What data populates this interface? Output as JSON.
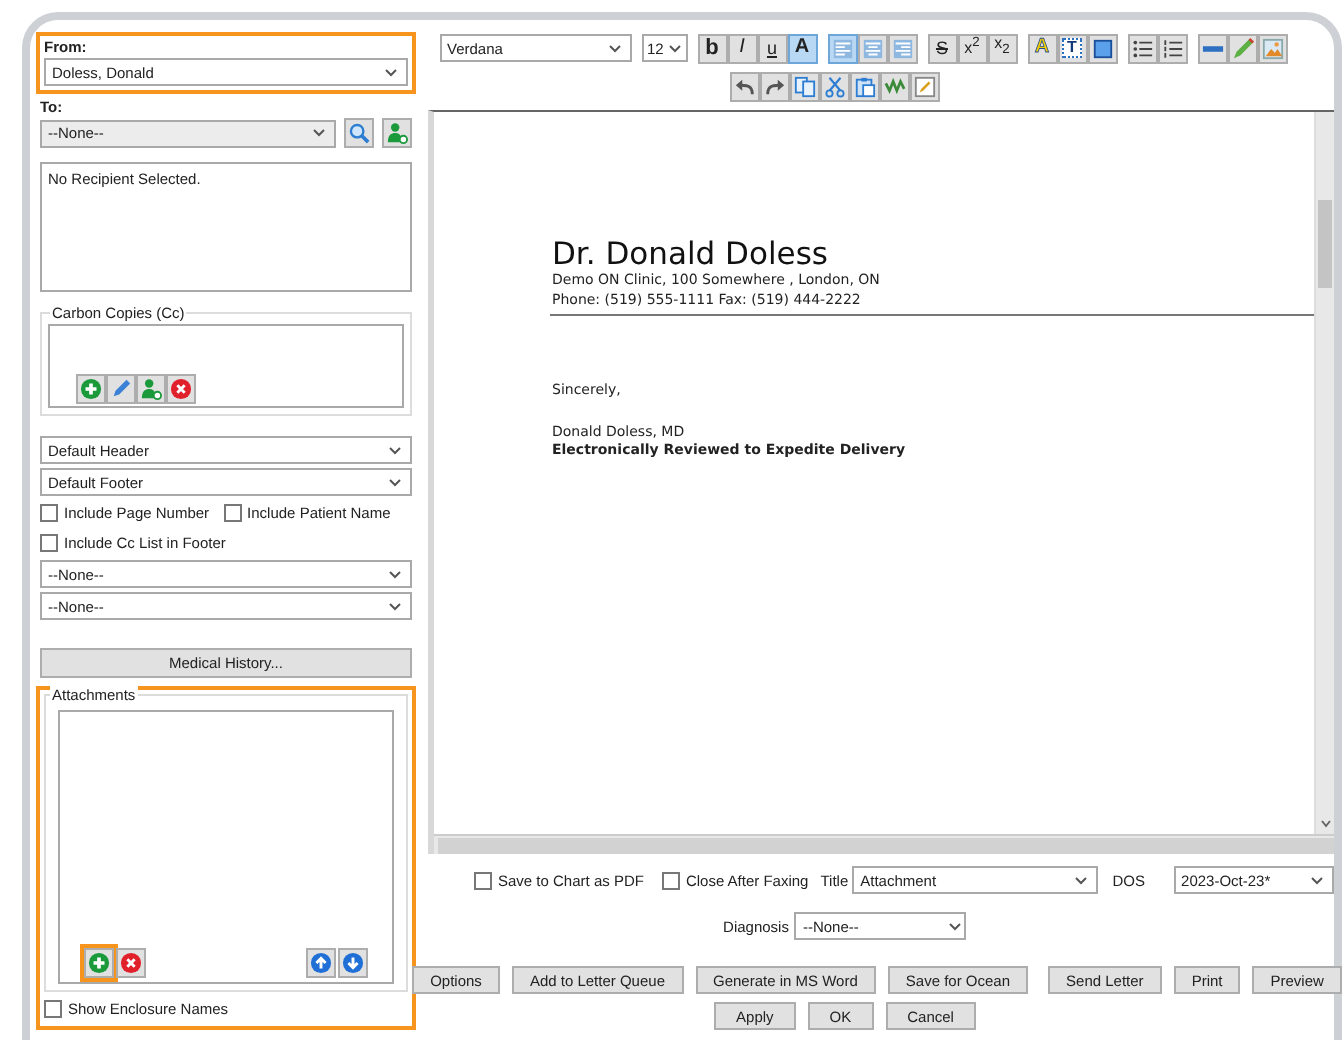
{
  "from": {
    "label": "From:",
    "value": "Doless, Donald",
    "highlighted": true
  },
  "to": {
    "label": "To:",
    "value": "--None--"
  },
  "recipients": {
    "text": "No Recipient Selected."
  },
  "carbon_copies": {
    "label": "Carbon Copies (Cc)"
  },
  "header": "Default Header",
  "footer": "Default Footer",
  "options": [
    {
      "label": "Include Page Number",
      "checked": false
    },
    {
      "label": "Include Patient Name",
      "checked": false
    },
    {
      "label": "Include Cc List in Footer",
      "checked": false
    }
  ],
  "selects": [
    "--None--",
    "--None--"
  ],
  "medical_history": "Medical History...",
  "attachments": {
    "label": "Attachments",
    "highlighted": true,
    "add_highlighted": true,
    "show_enclosure_names": {
      "label": "Show Enclosure Names",
      "checked": false
    }
  },
  "toolbar": {
    "font": "Verdana",
    "size": "12",
    "groups": [
      [
        {
          "kind": "bold",
          "label": "b",
          "selected": false
        },
        {
          "kind": "italic",
          "label": "I",
          "selected": false
        },
        {
          "kind": "underline",
          "label": "u",
          "selected": false
        },
        {
          "kind": "color",
          "label": "A",
          "selected": true
        }
      ],
      [
        {
          "kind": "align-left",
          "selected": true
        },
        {
          "kind": "align-center",
          "selected": false
        },
        {
          "kind": "align-right",
          "selected": false
        }
      ],
      [
        {
          "kind": "strike",
          "label": "S",
          "selected": false
        },
        {
          "kind": "superscript",
          "label": "x$^{2}$",
          "selected": false
        },
        {
          "kind": "subscript",
          "label": "x$_{2}$",
          "selected": false
        }
      ],
      [
        {
          "kind": "highlight",
          "label": "A",
          "selected": false
        },
        {
          "kind": "textbox",
          "label": "T",
          "selected": false
        },
        {
          "kind": "border",
          "selected": false
        }
      ],
      [
        {
          "kind": "bullets",
          "selected": false
        },
        {
          "kind": "numbered",
          "selected": false
        }
      ],
      [
        {
          "kind": "hr",
          "selected": false
        },
        {
          "kind": "pen",
          "selected": false
        },
        {
          "kind": "image",
          "selected": false
        }
      ]
    ],
    "tools": [
      {
        "kind": "undo"
      },
      {
        "kind": "redo"
      },
      {
        "kind": "copy"
      },
      {
        "kind": "cut"
      },
      {
        "kind": "paste"
      },
      {
        "kind": "spellcheck"
      },
      {
        "kind": "edit"
      }
    ]
  },
  "document": {
    "heading": "Dr. Donald Doless",
    "address": "Demo ON Clinic, 100 Somewhere , London, ON",
    "phone": "Phone: (519) 555-1111 Fax: (519) 444-2222",
    "closing": "Sincerely,",
    "signature": "Donald Doless, MD",
    "note": "Electronically Reviewed to Expedite Delivery"
  },
  "bottom": {
    "checks": [
      {
        "label": "Save to Chart as PDF",
        "checked": false
      },
      {
        "label": "Close After Faxing",
        "checked": false
      }
    ],
    "title": {
      "label": "Title",
      "value": "Attachment"
    },
    "dos": {
      "label": "DOS",
      "value": "2023-Oct-23*"
    },
    "diagnosis": {
      "label": "Diagnosis",
      "value": "--None--"
    },
    "actions": [
      [
        "Options",
        "Add to Letter Queue",
        "Generate in MS Word",
        "Save for Ocean"
      ],
      [
        "Send Letter",
        "Print",
        "Preview"
      ]
    ],
    "dialog_buttons": [
      "Apply",
      "OK",
      "Cancel"
    ]
  }
}
